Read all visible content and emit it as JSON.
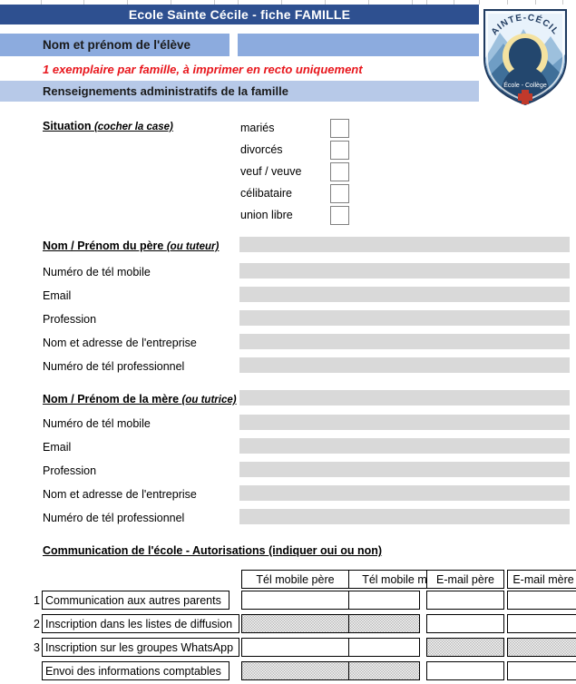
{
  "document": {
    "title": "Ecole Sainte Cécile  -  fiche FAMILLE",
    "student_name_label": "Nom et prénom de l'élève",
    "student_name_value": "",
    "print_note": "1 exemplaire par famille, à imprimer en recto uniquement",
    "section_heading": "Renseignements administratifs de la famille"
  },
  "logo": {
    "arc_text": "SAINTE-CÉCILE",
    "subtitle": "École - Collège",
    "icon": "shield-crest-icon",
    "colors": {
      "outline": "#1f3a5f",
      "sky": "#cfe2f3",
      "mountain": "#7fa8cc",
      "halo": "#f2df9a",
      "figure": "#1f3a5f",
      "cross": "#c0392b"
    }
  },
  "colors": {
    "title_bar": "#2e5090",
    "label_bar": "#8cabde",
    "section_bar": "#b7c9e8",
    "note_red": "#e8161c",
    "field_gray": "#d9d9d9",
    "checkbox_border": "#808080"
  },
  "situation": {
    "heading_plain": "Situation ",
    "heading_italic": "(cocher la case)",
    "options": [
      {
        "label": "mariés",
        "checked": false
      },
      {
        "label": "divorcés",
        "checked": false
      },
      {
        "label": "veuf / veuve",
        "checked": false
      },
      {
        "label": "célibataire",
        "checked": false
      },
      {
        "label": "union libre",
        "checked": false
      }
    ]
  },
  "father": {
    "heading_plain": "Nom / Prénom du père ",
    "heading_italic": "(ou tuteur)",
    "fields": [
      {
        "label": "Numéro de tél mobile",
        "value": ""
      },
      {
        "label": "Email",
        "value": ""
      },
      {
        "label": "Profession",
        "value": ""
      },
      {
        "label": "Nom et adresse de l'entreprise",
        "value": ""
      },
      {
        "label": "Numéro de tél professionnel",
        "value": ""
      }
    ]
  },
  "mother": {
    "heading_plain": "Nom / Prénom de la mère ",
    "heading_italic": "(ou tutrice)",
    "fields": [
      {
        "label": "Numéro de tél mobile",
        "value": ""
      },
      {
        "label": "Email",
        "value": ""
      },
      {
        "label": "Profession",
        "value": ""
      },
      {
        "label": "Nom et adresse de l'entreprise",
        "value": ""
      },
      {
        "label": "Numéro de tél professionnel",
        "value": ""
      }
    ]
  },
  "communication": {
    "title": "Communication de l'école - Autorisations (indiquer oui ou non)",
    "columns": [
      "Tél mobile père",
      "Tél mobile mère",
      "E-mail père",
      "E-mail mère"
    ],
    "rows": [
      {
        "number": "1",
        "label": "Communication aux autres parents",
        "cells": [
          {
            "value": "",
            "blocked": false
          },
          {
            "value": "",
            "blocked": false
          },
          {
            "value": "",
            "blocked": false
          },
          {
            "value": "",
            "blocked": false
          }
        ]
      },
      {
        "number": "2",
        "label": "Inscription dans les listes de diffusion",
        "cells": [
          {
            "value": "",
            "blocked": true
          },
          {
            "value": "",
            "blocked": true
          },
          {
            "value": "",
            "blocked": false
          },
          {
            "value": "",
            "blocked": false
          }
        ]
      },
      {
        "number": "3",
        "label": "Inscription sur les groupes WhatsApp",
        "cells": [
          {
            "value": "",
            "blocked": false
          },
          {
            "value": "",
            "blocked": false
          },
          {
            "value": "",
            "blocked": true
          },
          {
            "value": "",
            "blocked": true
          }
        ]
      },
      {
        "number": "",
        "label": "Envoi des informations comptables",
        "cells": [
          {
            "value": "",
            "blocked": true
          },
          {
            "value": "",
            "blocked": true
          },
          {
            "value": "",
            "blocked": false
          },
          {
            "value": "",
            "blocked": false
          }
        ]
      }
    ]
  }
}
